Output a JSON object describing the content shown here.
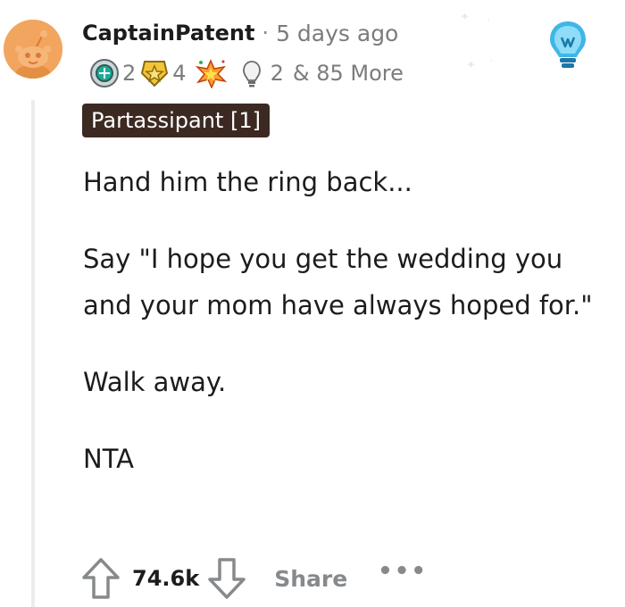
{
  "comment": {
    "username": "CaptainPatent",
    "separator": "·",
    "timestamp": "5 days ago",
    "awards": [
      {
        "icon": "silver-coin-award-icon",
        "count": "2"
      },
      {
        "icon": "gold-star-award-icon",
        "count": "4"
      },
      {
        "icon": "starburst-award-icon",
        "count": ""
      },
      {
        "icon": "lightbulb-award-icon",
        "count": "2"
      }
    ],
    "awards_more": "& 85 More",
    "flair": "Partassipant [1]",
    "paragraphs": [
      "Hand him the ring back...",
      "Say \"I hope you get the wedding you and your mom have always hoped for.\"",
      "Walk away.",
      "NTA"
    ],
    "score": "74.6k",
    "share_label": "Share",
    "more_label": "•••"
  },
  "colors": {
    "avatar_bg": "#f2a55e",
    "flair_bg": "#3c2a22",
    "meta_text": "#7c7c7c",
    "action_gray": "#878a8c",
    "bulb_blue": "#3fb6e8"
  }
}
